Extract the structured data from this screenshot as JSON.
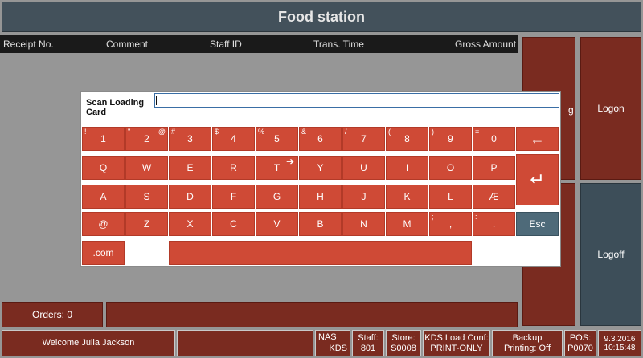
{
  "title": "Food station",
  "columns": [
    "Receipt No.",
    "Comment",
    "Staff ID",
    "Trans. Time",
    "Gross Amount"
  ],
  "side_buttons": {
    "login_partial": "g",
    "logon": "Logon",
    "logoff": "Logoff"
  },
  "orders_label": "Orders: 0",
  "status": {
    "welcome": "Welcome Julia Jackson",
    "nas": "NAS",
    "kds": "KDS",
    "staff_label": "Staff:",
    "staff_value": "801",
    "store_label": "Store:",
    "store_value": "S0008",
    "kds_conf_label": "KDS Load Conf:",
    "kds_conf_value": "PRINT-ONLY",
    "backup_label": "Backup",
    "backup_value": "Printing: Off",
    "pos_label": "POS:",
    "pos_value": "P0070",
    "date": "9.3.2016",
    "time": "10:15:48"
  },
  "dialog": {
    "label": "Scan Loading Card",
    "input_value": ""
  },
  "keyboard": {
    "row1": [
      {
        "k": "1",
        "s": "!",
        "a": ""
      },
      {
        "k": "2",
        "s": "\"",
        "a": "@"
      },
      {
        "k": "3",
        "s": "#",
        "a": ""
      },
      {
        "k": "4",
        "s": "$",
        "a": ""
      },
      {
        "k": "5",
        "s": "%",
        "a": ""
      },
      {
        "k": "6",
        "s": "&",
        "a": ""
      },
      {
        "k": "7",
        "s": "/",
        "a": ""
      },
      {
        "k": "8",
        "s": "(",
        "a": ""
      },
      {
        "k": "9",
        "s": ")",
        "a": ""
      },
      {
        "k": "0",
        "s": "=",
        "a": ""
      }
    ],
    "row2": [
      "Q",
      "W",
      "E",
      "R",
      "T",
      "Y",
      "U",
      "I",
      "O",
      "P"
    ],
    "row3": [
      "A",
      "S",
      "D",
      "F",
      "G",
      "H",
      "J",
      "K",
      "L",
      "Æ"
    ],
    "row4": [
      {
        "k": "@",
        "s": ""
      },
      {
        "k": "Z",
        "s": ""
      },
      {
        "k": "X",
        "s": ""
      },
      {
        "k": "C",
        "s": ""
      },
      {
        "k": "V",
        "s": ""
      },
      {
        "k": "B",
        "s": ""
      },
      {
        "k": "N",
        "s": ""
      },
      {
        "k": "M",
        "s": ""
      },
      {
        "k": ",",
        "s": ";"
      },
      {
        "k": ".",
        "s": ":"
      }
    ],
    "backspace": "←",
    "enter": "↵",
    "esc": "Esc",
    "dotcom": ".com",
    "cursor_glyph": "➔"
  }
}
